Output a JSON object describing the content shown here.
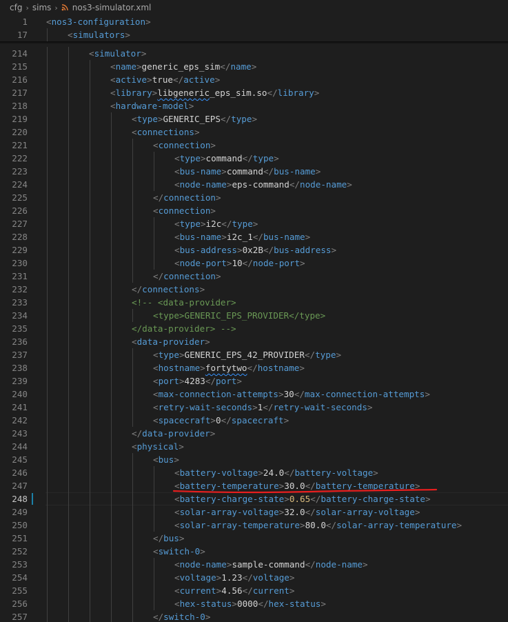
{
  "breadcrumb": {
    "items": [
      "cfg",
      "sims",
      "nos3-simulator.xml"
    ],
    "file_icon": "rss-xml-icon"
  },
  "sticky_lines": [
    {
      "num": "1",
      "indent": 0,
      "tokens": [
        [
          "t",
          "<"
        ],
        [
          "n",
          "nos3-configuration"
        ],
        [
          "t",
          ">"
        ]
      ]
    },
    {
      "num": "17",
      "indent": 1,
      "tokens": [
        [
          "t",
          "<"
        ],
        [
          "n",
          "simulators"
        ],
        [
          "t",
          ">"
        ]
      ]
    }
  ],
  "lines": [
    {
      "num": "214",
      "indent": 2,
      "tokens": [
        [
          "t",
          "<"
        ],
        [
          "n",
          "simulator"
        ],
        [
          "t",
          ">"
        ]
      ]
    },
    {
      "num": "215",
      "indent": 3,
      "tokens": [
        [
          "t",
          "<"
        ],
        [
          "n",
          "name"
        ],
        [
          "t",
          ">"
        ],
        [
          "x",
          "generic_eps_sim"
        ],
        [
          "t",
          "</"
        ],
        [
          "n",
          "name"
        ],
        [
          "t",
          ">"
        ]
      ]
    },
    {
      "num": "216",
      "indent": 3,
      "tokens": [
        [
          "t",
          "<"
        ],
        [
          "n",
          "active"
        ],
        [
          "t",
          ">"
        ],
        [
          "x",
          "true"
        ],
        [
          "t",
          "</"
        ],
        [
          "n",
          "active"
        ],
        [
          "t",
          ">"
        ]
      ]
    },
    {
      "num": "217",
      "indent": 3,
      "tokens": [
        [
          "t",
          "<"
        ],
        [
          "n",
          "library"
        ],
        [
          "t",
          ">"
        ],
        [
          "xw",
          "libgeneric"
        ],
        [
          "x",
          "_eps_sim.so"
        ],
        [
          "t",
          "</"
        ],
        [
          "n",
          "library"
        ],
        [
          "t",
          ">"
        ]
      ]
    },
    {
      "num": "218",
      "indent": 3,
      "tokens": [
        [
          "t",
          "<"
        ],
        [
          "n",
          "hardware-model"
        ],
        [
          "t",
          ">"
        ]
      ]
    },
    {
      "num": "219",
      "indent": 4,
      "tokens": [
        [
          "t",
          "<"
        ],
        [
          "n",
          "type"
        ],
        [
          "t",
          ">"
        ],
        [
          "x",
          "GENERIC_EPS"
        ],
        [
          "t",
          "</"
        ],
        [
          "n",
          "type"
        ],
        [
          "t",
          ">"
        ]
      ]
    },
    {
      "num": "220",
      "indent": 4,
      "tokens": [
        [
          "t",
          "<"
        ],
        [
          "n",
          "connections"
        ],
        [
          "t",
          ">"
        ]
      ]
    },
    {
      "num": "221",
      "indent": 5,
      "tokens": [
        [
          "t",
          "<"
        ],
        [
          "n",
          "connection"
        ],
        [
          "t",
          ">"
        ]
      ]
    },
    {
      "num": "222",
      "indent": 6,
      "tokens": [
        [
          "t",
          "<"
        ],
        [
          "n",
          "type"
        ],
        [
          "t",
          ">"
        ],
        [
          "x",
          "command"
        ],
        [
          "t",
          "</"
        ],
        [
          "n",
          "type"
        ],
        [
          "t",
          ">"
        ]
      ]
    },
    {
      "num": "223",
      "indent": 6,
      "tokens": [
        [
          "t",
          "<"
        ],
        [
          "n",
          "bus-name"
        ],
        [
          "t",
          ">"
        ],
        [
          "x",
          "command"
        ],
        [
          "t",
          "</"
        ],
        [
          "n",
          "bus-name"
        ],
        [
          "t",
          ">"
        ]
      ]
    },
    {
      "num": "224",
      "indent": 6,
      "tokens": [
        [
          "t",
          "<"
        ],
        [
          "n",
          "node-name"
        ],
        [
          "t",
          ">"
        ],
        [
          "x",
          "eps-command"
        ],
        [
          "t",
          "</"
        ],
        [
          "n",
          "node-name"
        ],
        [
          "t",
          ">"
        ]
      ]
    },
    {
      "num": "225",
      "indent": 5,
      "tokens": [
        [
          "t",
          "</"
        ],
        [
          "n",
          "connection"
        ],
        [
          "t",
          ">"
        ]
      ]
    },
    {
      "num": "226",
      "indent": 5,
      "tokens": [
        [
          "t",
          "<"
        ],
        [
          "n",
          "connection"
        ],
        [
          "t",
          ">"
        ]
      ]
    },
    {
      "num": "227",
      "indent": 6,
      "tokens": [
        [
          "t",
          "<"
        ],
        [
          "n",
          "type"
        ],
        [
          "t",
          ">"
        ],
        [
          "x",
          "i2c"
        ],
        [
          "t",
          "</"
        ],
        [
          "n",
          "type"
        ],
        [
          "t",
          ">"
        ]
      ]
    },
    {
      "num": "228",
      "indent": 6,
      "tokens": [
        [
          "t",
          "<"
        ],
        [
          "n",
          "bus-name"
        ],
        [
          "t",
          ">"
        ],
        [
          "x",
          "i2c_1"
        ],
        [
          "t",
          "</"
        ],
        [
          "n",
          "bus-name"
        ],
        [
          "t",
          ">"
        ]
      ]
    },
    {
      "num": "229",
      "indent": 6,
      "tokens": [
        [
          "t",
          "<"
        ],
        [
          "n",
          "bus-address"
        ],
        [
          "t",
          ">"
        ],
        [
          "x",
          "0x2B"
        ],
        [
          "t",
          "</"
        ],
        [
          "n",
          "bus-address"
        ],
        [
          "t",
          ">"
        ]
      ]
    },
    {
      "num": "230",
      "indent": 6,
      "tokens": [
        [
          "t",
          "<"
        ],
        [
          "n",
          "node-port"
        ],
        [
          "t",
          ">"
        ],
        [
          "x",
          "10"
        ],
        [
          "t",
          "</"
        ],
        [
          "n",
          "node-port"
        ],
        [
          "t",
          ">"
        ]
      ]
    },
    {
      "num": "231",
      "indent": 5,
      "tokens": [
        [
          "t",
          "</"
        ],
        [
          "n",
          "connection"
        ],
        [
          "t",
          ">"
        ]
      ]
    },
    {
      "num": "232",
      "indent": 4,
      "tokens": [
        [
          "t",
          "</"
        ],
        [
          "n",
          "connections"
        ],
        [
          "t",
          ">"
        ]
      ]
    },
    {
      "num": "233",
      "indent": 4,
      "tokens": [
        [
          "c",
          "<!-- <data-provider>"
        ]
      ]
    },
    {
      "num": "234",
      "indent": 5,
      "tokens": [
        [
          "c",
          "<type>GENERIC_EPS_PROVIDER</type>"
        ]
      ]
    },
    {
      "num": "235",
      "indent": 4,
      "tokens": [
        [
          "c",
          "</data-provider> -->"
        ]
      ]
    },
    {
      "num": "236",
      "indent": 4,
      "tokens": [
        [
          "t",
          "<"
        ],
        [
          "n",
          "data-provider"
        ],
        [
          "t",
          ">"
        ]
      ]
    },
    {
      "num": "237",
      "indent": 5,
      "tokens": [
        [
          "t",
          "<"
        ],
        [
          "n",
          "type"
        ],
        [
          "t",
          ">"
        ],
        [
          "x",
          "GENERIC_EPS_42_PROVIDER"
        ],
        [
          "t",
          "</"
        ],
        [
          "n",
          "type"
        ],
        [
          "t",
          ">"
        ]
      ]
    },
    {
      "num": "238",
      "indent": 5,
      "tokens": [
        [
          "t",
          "<"
        ],
        [
          "n",
          "hostname"
        ],
        [
          "t",
          ">"
        ],
        [
          "xw",
          "fortytwo"
        ],
        [
          "t",
          "</"
        ],
        [
          "n",
          "hostname"
        ],
        [
          "t",
          ">"
        ]
      ]
    },
    {
      "num": "239",
      "indent": 5,
      "tokens": [
        [
          "t",
          "<"
        ],
        [
          "n",
          "port"
        ],
        [
          "t",
          ">"
        ],
        [
          "x",
          "4283"
        ],
        [
          "t",
          "</"
        ],
        [
          "n",
          "port"
        ],
        [
          "t",
          ">"
        ]
      ]
    },
    {
      "num": "240",
      "indent": 5,
      "tokens": [
        [
          "t",
          "<"
        ],
        [
          "n",
          "max-connection-attempts"
        ],
        [
          "t",
          ">"
        ],
        [
          "x",
          "30"
        ],
        [
          "t",
          "</"
        ],
        [
          "n",
          "max-connection-attempts"
        ],
        [
          "t",
          ">"
        ]
      ]
    },
    {
      "num": "241",
      "indent": 5,
      "tokens": [
        [
          "t",
          "<"
        ],
        [
          "n",
          "retry-wait-seconds"
        ],
        [
          "t",
          ">"
        ],
        [
          "x",
          "1"
        ],
        [
          "t",
          "</"
        ],
        [
          "n",
          "retry-wait-seconds"
        ],
        [
          "t",
          ">"
        ]
      ]
    },
    {
      "num": "242",
      "indent": 5,
      "tokens": [
        [
          "t",
          "<"
        ],
        [
          "n",
          "spacecraft"
        ],
        [
          "t",
          ">"
        ],
        [
          "x",
          "0"
        ],
        [
          "t",
          "</"
        ],
        [
          "n",
          "spacecraft"
        ],
        [
          "t",
          ">"
        ]
      ]
    },
    {
      "num": "243",
      "indent": 4,
      "tokens": [
        [
          "t",
          "</"
        ],
        [
          "n",
          "data-provider"
        ],
        [
          "t",
          ">"
        ]
      ]
    },
    {
      "num": "244",
      "indent": 4,
      "tokens": [
        [
          "t",
          "<"
        ],
        [
          "n",
          "physical"
        ],
        [
          "t",
          ">"
        ]
      ]
    },
    {
      "num": "245",
      "indent": 5,
      "tokens": [
        [
          "t",
          "<"
        ],
        [
          "n",
          "bus"
        ],
        [
          "t",
          ">"
        ]
      ]
    },
    {
      "num": "246",
      "indent": 6,
      "tokens": [
        [
          "t",
          "<"
        ],
        [
          "n",
          "battery-voltage"
        ],
        [
          "t",
          ">"
        ],
        [
          "x",
          "24.0"
        ],
        [
          "t",
          "</"
        ],
        [
          "n",
          "battery-voltage"
        ],
        [
          "t",
          ">"
        ]
      ]
    },
    {
      "num": "247",
      "indent": 6,
      "tokens": [
        [
          "t",
          "<"
        ],
        [
          "n",
          "battery-temperature"
        ],
        [
          "t",
          ">"
        ],
        [
          "x",
          "30.0"
        ],
        [
          "t",
          "</"
        ],
        [
          "n",
          "battery-temperature"
        ],
        [
          "t",
          ">"
        ]
      ]
    },
    {
      "num": "248",
      "indent": 6,
      "active": true,
      "tokens": [
        [
          "t",
          "<"
        ],
        [
          "n",
          "battery-charge-state"
        ],
        [
          "t",
          ">"
        ],
        [
          "hl",
          "0.65"
        ],
        [
          "t",
          "</"
        ],
        [
          "n",
          "battery-charge-state"
        ],
        [
          "t",
          ">"
        ]
      ]
    },
    {
      "num": "249",
      "indent": 6,
      "tokens": [
        [
          "t",
          "<"
        ],
        [
          "n",
          "solar-array-voltage"
        ],
        [
          "t",
          ">"
        ],
        [
          "x",
          "32.0"
        ],
        [
          "t",
          "</"
        ],
        [
          "n",
          "solar-array-voltage"
        ],
        [
          "t",
          ">"
        ]
      ]
    },
    {
      "num": "250",
      "indent": 6,
      "tokens": [
        [
          "t",
          "<"
        ],
        [
          "n",
          "solar-array-temperature"
        ],
        [
          "t",
          ">"
        ],
        [
          "x",
          "80.0"
        ],
        [
          "t",
          "</"
        ],
        [
          "n",
          "solar-array-temperature"
        ],
        [
          "t",
          ">"
        ]
      ]
    },
    {
      "num": "251",
      "indent": 5,
      "tokens": [
        [
          "t",
          "</"
        ],
        [
          "n",
          "bus"
        ],
        [
          "t",
          ">"
        ]
      ]
    },
    {
      "num": "252",
      "indent": 5,
      "tokens": [
        [
          "t",
          "<"
        ],
        [
          "n",
          "switch-0"
        ],
        [
          "t",
          ">"
        ]
      ]
    },
    {
      "num": "253",
      "indent": 6,
      "tokens": [
        [
          "t",
          "<"
        ],
        [
          "n",
          "node-name"
        ],
        [
          "t",
          ">"
        ],
        [
          "x",
          "sample-command"
        ],
        [
          "t",
          "</"
        ],
        [
          "n",
          "node-name"
        ],
        [
          "t",
          ">"
        ]
      ]
    },
    {
      "num": "254",
      "indent": 6,
      "tokens": [
        [
          "t",
          "<"
        ],
        [
          "n",
          "voltage"
        ],
        [
          "t",
          ">"
        ],
        [
          "x",
          "1.23"
        ],
        [
          "t",
          "</"
        ],
        [
          "n",
          "voltage"
        ],
        [
          "t",
          ">"
        ]
      ]
    },
    {
      "num": "255",
      "indent": 6,
      "tokens": [
        [
          "t",
          "<"
        ],
        [
          "n",
          "current"
        ],
        [
          "t",
          ">"
        ],
        [
          "x",
          "4.56"
        ],
        [
          "t",
          "</"
        ],
        [
          "n",
          "current"
        ],
        [
          "t",
          ">"
        ]
      ]
    },
    {
      "num": "256",
      "indent": 6,
      "tokens": [
        [
          "t",
          "<"
        ],
        [
          "n",
          "hex-status"
        ],
        [
          "t",
          ">"
        ],
        [
          "x",
          "0000"
        ],
        [
          "t",
          "</"
        ],
        [
          "n",
          "hex-status"
        ],
        [
          "t",
          ">"
        ]
      ]
    },
    {
      "num": "257",
      "indent": 5,
      "tokens": [
        [
          "t",
          "</"
        ],
        [
          "n",
          "switch-0"
        ],
        [
          "t",
          ">"
        ]
      ]
    }
  ],
  "annotation": {
    "color": "#e81e1e",
    "target_line": "248"
  }
}
